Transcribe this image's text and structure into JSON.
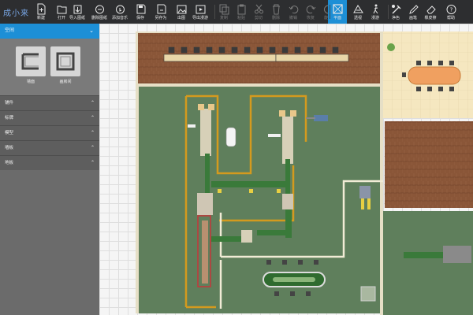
{
  "app": {
    "logo": "成小来"
  },
  "toolbar": {
    "buttons": [
      {
        "id": "new",
        "label": "新建",
        "icon": "new-file-icon",
        "enabled": true
      },
      {
        "id": "open",
        "label": "打开",
        "icon": "open-folder-icon",
        "enabled": true
      },
      {
        "id": "import",
        "label": "导入图纸",
        "icon": "import-icon",
        "enabled": true
      },
      {
        "id": "delete-drawing",
        "label": "删除图纸",
        "icon": "delete-drawing-icon",
        "enabled": true
      },
      {
        "id": "add-music",
        "label": "添加音乐",
        "icon": "music-icon",
        "enabled": true
      },
      {
        "id": "save",
        "label": "保存",
        "icon": "save-icon",
        "enabled": true
      },
      {
        "id": "save-as",
        "label": "另存为",
        "icon": "save-as-icon",
        "enabled": true
      },
      {
        "id": "export-image",
        "label": "出图",
        "icon": "image-icon",
        "enabled": true
      },
      {
        "id": "export-tour",
        "label": "导出漫游",
        "icon": "export-tour-icon",
        "enabled": true
      },
      {
        "id": "copy",
        "label": "复制",
        "icon": "copy-icon",
        "enabled": false
      },
      {
        "id": "paste",
        "label": "粘贴",
        "icon": "paste-icon",
        "enabled": false
      },
      {
        "id": "cut",
        "label": "剪切",
        "icon": "cut-icon",
        "enabled": false
      },
      {
        "id": "delete",
        "label": "删除",
        "icon": "trash-icon",
        "enabled": false
      },
      {
        "id": "undo",
        "label": "撤销",
        "icon": "undo-icon",
        "enabled": false
      },
      {
        "id": "redo",
        "label": "恢复",
        "icon": "redo-icon",
        "enabled": false
      },
      {
        "id": "rotate",
        "label": "旋转",
        "icon": "rotate-icon",
        "enabled": false
      },
      {
        "id": "plan-view",
        "label": "平面",
        "icon": "plan-view-icon",
        "enabled": true,
        "active": true
      },
      {
        "id": "perspective",
        "label": "透视",
        "icon": "perspective-icon",
        "enabled": true
      },
      {
        "id": "tour",
        "label": "漫游",
        "icon": "walk-icon",
        "enabled": true
      },
      {
        "id": "clean",
        "label": "净色",
        "icon": "clean-color-icon",
        "enabled": true
      },
      {
        "id": "pen",
        "label": "画笔",
        "icon": "pen-icon",
        "enabled": true
      },
      {
        "id": "eraser",
        "label": "橡皮擦",
        "icon": "eraser-icon",
        "enabled": true
      },
      {
        "id": "help",
        "label": "帮助",
        "icon": "help-icon",
        "enabled": true
      }
    ]
  },
  "panel": {
    "header": "空间",
    "tools": [
      {
        "label": "墙面",
        "icon": "wall-tool-icon"
      },
      {
        "label": "画房间",
        "icon": "draw-room-icon"
      }
    ],
    "sections": [
      "铺件",
      "标牌",
      "模型",
      "墙板",
      "地板"
    ]
  },
  "colors": {
    "accent": "#1d8fd6",
    "floor_green": "#5f7f5c",
    "wood_floor": "#8b5a3c",
    "orange_line": "#d49a1e"
  }
}
